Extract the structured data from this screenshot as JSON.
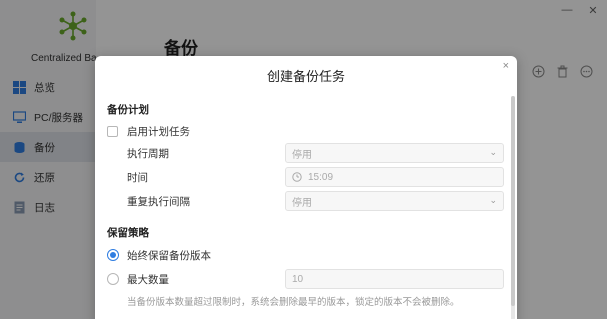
{
  "app": {
    "brand": "Centralized Ba",
    "page_title": "备份",
    "nav": [
      {
        "label": "总览",
        "icon": "overview-grid-icon"
      },
      {
        "label": "PC/服务器",
        "icon": "pc-server-icon"
      },
      {
        "label": "备份",
        "icon": "backup-database-icon"
      },
      {
        "label": "还原",
        "icon": "restore-icon"
      },
      {
        "label": "日志",
        "icon": "log-icon"
      }
    ],
    "accent_color": "#2f7de1"
  },
  "modal": {
    "title": "创建备份任务",
    "close_symbol": "×",
    "schedule": {
      "section_title": "备份计划",
      "enable_label": "启用计划任务",
      "enable_checked": false,
      "period_label": "执行周期",
      "period_value": "停用",
      "time_label": "时间",
      "time_value": "15:09",
      "repeat_label": "重复执行间隔",
      "repeat_value": "停用"
    },
    "retention": {
      "section_title": "保留策略",
      "keep_all_label": "始终保留备份版本",
      "keep_all_selected": true,
      "max_label": "最大数量",
      "max_selected": false,
      "max_value": "10",
      "hint": "当备份版本数量超过限制时，系统会删除最早的版本，锁定的版本不会被删除。"
    }
  }
}
